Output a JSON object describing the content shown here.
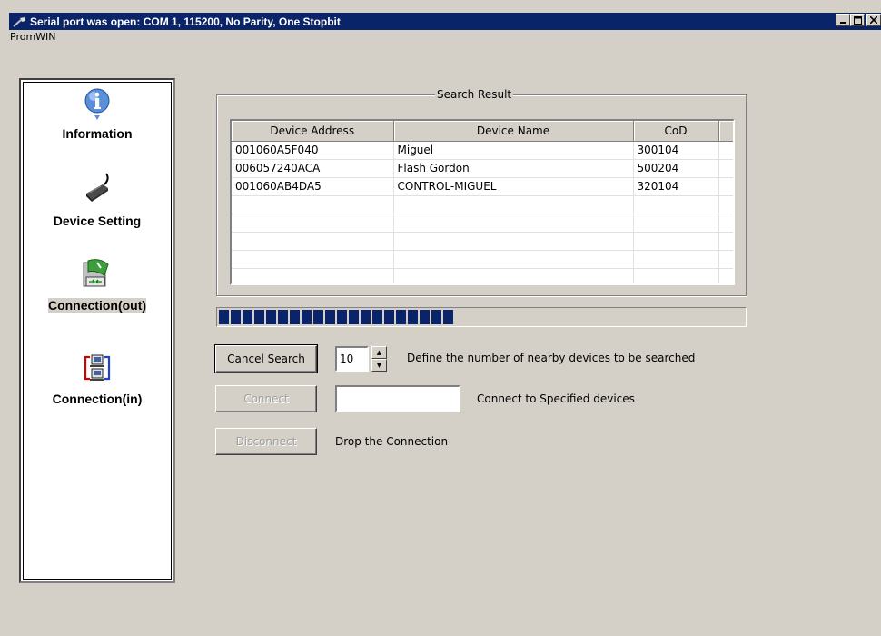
{
  "window": {
    "title": "Serial port was open: COM 1, 115200, No Parity, One Stopbit",
    "menu": "PromWIN"
  },
  "nav": {
    "items": [
      {
        "label": "Information",
        "icon": "info-icon"
      },
      {
        "label": "Device Setting",
        "icon": "serial-device-icon"
      },
      {
        "label": "Connection(out)",
        "icon": "connection-out-icon",
        "selected": true
      },
      {
        "label": "Connection(in)",
        "icon": "connection-in-icon"
      }
    ]
  },
  "search": {
    "group_title": "Search Result",
    "columns": [
      "Device Address",
      "Device Name",
      "CoD"
    ],
    "rows": [
      [
        "001060A5F040",
        "Miguel",
        "300104"
      ],
      [
        "006057240ACA",
        "Flash Gordon",
        "500204"
      ],
      [
        "001060AB4DA5",
        "CONTROL-MIGUEL",
        "320104"
      ]
    ],
    "progress_fraction": 0.45
  },
  "controls": {
    "cancel_search_label": "Cancel Search",
    "device_count": "10",
    "device_count_description": "Define the number of nearby devices to be searched",
    "connect_label": "Connect",
    "connect_target": "",
    "connect_description": "Connect to Specified devices",
    "disconnect_label": "Disconnect",
    "disconnect_description": "Drop the Connection"
  },
  "colors": {
    "titlebar": "#0a246a",
    "face": "#d4d0c8",
    "progress": "#0a246a"
  }
}
